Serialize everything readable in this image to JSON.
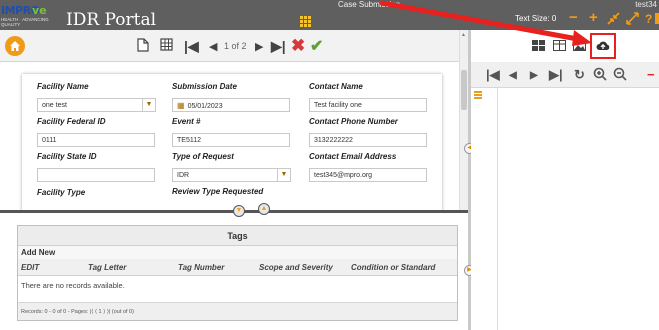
{
  "header": {
    "logo_text_a": "IMPRO",
    "logo_text_b": "ve",
    "logo_sub": "HEALTH · ADVANCING QUALITY",
    "title": "IDR Portal",
    "center_text": "Case Submission",
    "user": "test34",
    "text_size_label": "Text Size: 0",
    "help_glyph": "?",
    "icons": [
      "minus-icon",
      "plus-icon",
      "shrink-icon",
      "expand-icon",
      "help-icon",
      "logout-icon"
    ],
    "accent_color": "#f39c12"
  },
  "toolbar": {
    "pager_text": "1 of 2",
    "icons": [
      "home-icon",
      "document-icon",
      "grid-icon",
      "first-page-icon",
      "prev-page-icon",
      "next-page-icon",
      "last-page-icon",
      "delete-icon",
      "save-check-icon"
    ]
  },
  "form": {
    "fields": [
      {
        "label": "Facility Name",
        "value": "one test",
        "has_dropdown": true
      },
      {
        "label": "Submission Date",
        "value": "05/01/2023",
        "has_calendar": true
      },
      {
        "label": "Contact Name",
        "value": "Test facility one"
      },
      {
        "label": "Facility Federal ID",
        "value": "0111"
      },
      {
        "label": "Event #",
        "value": "TE5112"
      },
      {
        "label": "Contact Phone Number",
        "value": "3132222222"
      },
      {
        "label": "Facility State ID",
        "value": ""
      },
      {
        "label": "Type of Request",
        "value": "IDR",
        "has_dropdown": true
      },
      {
        "label": "Contact Email Address",
        "value": "test345@mpro.org"
      },
      {
        "label": "Facility Type",
        "value": ""
      },
      {
        "label": "Review Type Requested",
        "value": ""
      }
    ]
  },
  "tags": {
    "title": "Tags",
    "add_new": "Add New",
    "columns": [
      "EDIT",
      "Tag Letter",
      "Tag Number",
      "Scope and Severity",
      "Condition or Standard"
    ],
    "empty_text": "There are no records available.",
    "footer": "Records: 0 - 0 of 0 - Pages:   |⟨   ⟨   1   ⟩   ⟩|   (out of 0)"
  },
  "right_pane": {
    "toolbar_icons": [
      "thumbnails-icon",
      "two-page-icon",
      "image-icon",
      "upload-icon"
    ],
    "nav_icons": [
      "first-page-icon",
      "prev-page-icon",
      "next-page-icon",
      "last-page-icon",
      "rotate-icon",
      "zoom-in-icon",
      "zoom-out-icon"
    ],
    "highlight_color": "#e8201e"
  }
}
